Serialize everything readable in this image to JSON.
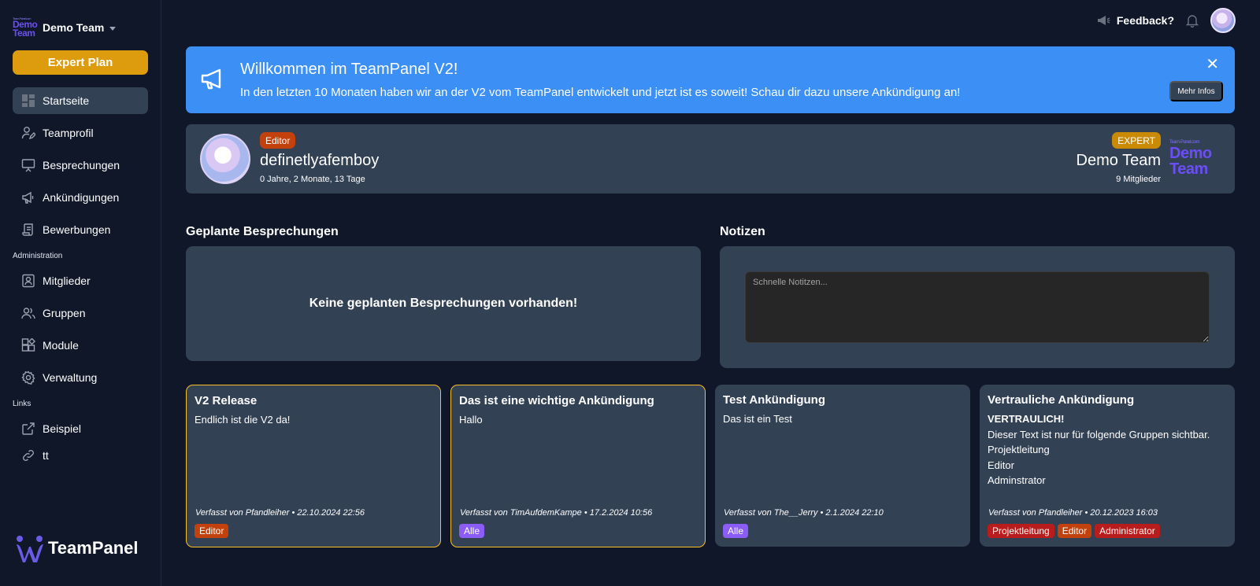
{
  "sidebar": {
    "team_logo_tiny": "Team-Panel.com",
    "team_logo_line1": "Demo",
    "team_logo_line2": "Team",
    "team_name": "Demo Team",
    "plan_button": "Expert Plan",
    "items": [
      {
        "label": "Startseite",
        "icon": "dashboard-icon"
      },
      {
        "label": "Teamprofil",
        "icon": "user-edit-icon"
      },
      {
        "label": "Besprechungen",
        "icon": "presentation-icon"
      },
      {
        "label": "Ankündigungen",
        "icon": "megaphone-icon"
      },
      {
        "label": "Bewerbungen",
        "icon": "scroll-icon"
      }
    ],
    "admin_label": "Administration",
    "admin_items": [
      {
        "label": "Mitglieder",
        "icon": "contact-icon"
      },
      {
        "label": "Gruppen",
        "icon": "users-icon"
      },
      {
        "label": "Module",
        "icon": "modules-icon"
      },
      {
        "label": "Verwaltung",
        "icon": "gear-icon"
      }
    ],
    "links_label": "Links",
    "link_items": [
      {
        "label": "Beispiel",
        "icon": "external-link-icon"
      },
      {
        "label": "tt",
        "icon": "link-icon"
      }
    ],
    "brand_name": "TeamPanel"
  },
  "topbar": {
    "feedback": "Feedback?"
  },
  "banner": {
    "title": "Willkommen im TeamPanel V2!",
    "text": "In den letzten 10 Monaten haben wir an der V2 vom TeamPanel entwickelt und jetzt ist es soweit! Schau dir dazu unsere Ankündigung an!",
    "close": "✕",
    "more_button": "Mehr Infos"
  },
  "profile": {
    "role": "Editor",
    "name": "definetlyafemboy",
    "membership": "0 Jahre, 2 Monate, 13 Tage",
    "plan": "EXPERT",
    "team": "Demo Team",
    "members": "9 Mitglieder",
    "logo_tiny": "Team-Panel.com",
    "logo_line1": "Demo",
    "logo_line2": "Team"
  },
  "meetings": {
    "heading": "Geplante Besprechungen",
    "empty": "Keine geplanten Besprechungen vorhanden!"
  },
  "notes": {
    "heading": "Notizen",
    "placeholder": "Schnelle Notitzen..."
  },
  "announcements": [
    {
      "title": "V2 Release",
      "body": [
        "Endlich ist die V2 da!"
      ],
      "meta": "Verfasst von Pfandleiher • 22.10.2024 22:56",
      "tags": [
        {
          "label": "Editor",
          "color": "#c2410c"
        }
      ],
      "pinned": true
    },
    {
      "title": "Das ist eine wichtige Ankündigung",
      "body": [
        "Hallo"
      ],
      "meta": "Verfasst von TimAufdemKampe • 17.2.2024 10:56",
      "tags": [
        {
          "label": "Alle",
          "color": "#8b5cf6"
        }
      ],
      "pinned": true
    },
    {
      "title": "Test Ankündigung",
      "body": [
        "Das ist ein Test"
      ],
      "meta": "Verfasst von The__Jerry • 2.1.2024 22:10",
      "tags": [
        {
          "label": "Alle",
          "color": "#8b5cf6"
        }
      ],
      "pinned": false
    },
    {
      "title": "Vertrauliche Ankündigung",
      "body_strong": "VERTRAULICH!",
      "body": [
        "Dieser Text ist nur für folgende Gruppen sichtbar.",
        "Projektleitung",
        "Editor",
        "Adminstrator"
      ],
      "meta": "Verfasst von Pfandleiher • 20.12.2023 16:03",
      "tags": [
        {
          "label": "Projektleitung",
          "color": "#b91c1c"
        },
        {
          "label": "Editor",
          "color": "#c2410c"
        },
        {
          "label": "Administrator",
          "color": "#b91c1c"
        }
      ],
      "pinned": false
    }
  ]
}
